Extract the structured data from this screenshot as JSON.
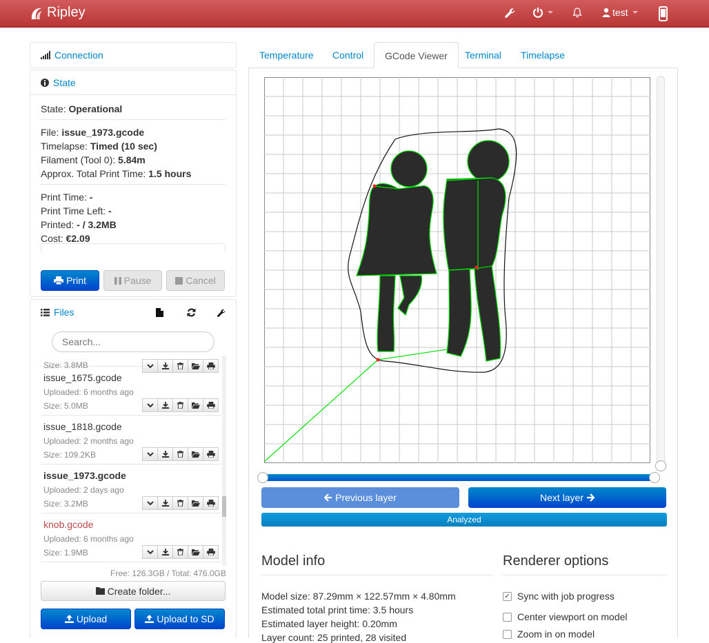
{
  "navbar": {
    "brand": "Ripley",
    "user": "test"
  },
  "sidebar": {
    "connection": {
      "title": "Connection"
    },
    "state": {
      "title": "State",
      "state_label": "State:",
      "state_value": "Operational",
      "file_label": "File:",
      "file_value": "issue_1973.gcode",
      "timelapse_label": "Timelapse:",
      "timelapse_value": "Timed (10 sec)",
      "filament_label": "Filament (Tool 0):",
      "filament_value": "5.84m",
      "approx_label": "Approx. Total Print Time:",
      "approx_value": "1.5 hours",
      "print_time_label": "Print Time:",
      "print_time_value": "-",
      "time_left_label": "Print Time Left:",
      "time_left_value": "-",
      "printed_label": "Printed:",
      "printed_value": "- / 3.2MB",
      "cost_label": "Cost:",
      "cost_value": "€2.09",
      "print_btn": "Print",
      "pause_btn": "Pause",
      "cancel_btn": "Cancel"
    },
    "files": {
      "title": "Files",
      "search_placeholder": "Search...",
      "partial_size": "Size: 3.8MB",
      "items": [
        {
          "name": "issue_1675.gcode",
          "uploaded": "Uploaded: 6 months ago",
          "size": "Size: 5.0MB",
          "style": "normal"
        },
        {
          "name": "issue_1818.gcode",
          "uploaded": "Uploaded: 2 months ago",
          "size": "Size: 109.2KB",
          "style": "normal"
        },
        {
          "name": "issue_1973.gcode",
          "uploaded": "Uploaded: 2 days ago",
          "size": "Size: 3.2MB",
          "style": "selected"
        },
        {
          "name": "knob.gcode",
          "uploaded": "Uploaded: 6 months ago",
          "size": "Size: 1.9MB",
          "style": "error"
        }
      ],
      "free_total": "Free: 126.3GB / Total: 476.0GB",
      "create_folder_btn": "Create folder...",
      "upload_btn": "Upload",
      "upload_sd_btn": "Upload to SD"
    }
  },
  "tabs": [
    "Temperature",
    "Control",
    "GCode Viewer",
    "Terminal",
    "Timelapse"
  ],
  "active_tab": "GCode Viewer",
  "viewer": {
    "prev_layer": "Previous layer",
    "next_layer": "Next layer",
    "analyzed": "Analyzed",
    "layer_slider_position": 1.0,
    "model_info": {
      "title": "Model info",
      "lines": [
        "Model size: 87.29mm × 122.57mm × 4.80mm",
        "Estimated total print time: 3.5 hours",
        "Estimated layer height: 0.20mm",
        "Layer count: 25 printed, 28 visited"
      ]
    },
    "renderer_options": {
      "title": "Renderer options",
      "options": [
        {
          "label": "Sync with job progress",
          "checked": true
        },
        {
          "label": "Center viewport on model",
          "checked": false
        },
        {
          "label": "Zoom in on model",
          "checked": false
        }
      ]
    }
  },
  "colors": {
    "navbar": "#c04040",
    "primary": "#0055cc",
    "link": "#0088cc",
    "travel": "#00e000",
    "error_file": "#b94a48"
  }
}
